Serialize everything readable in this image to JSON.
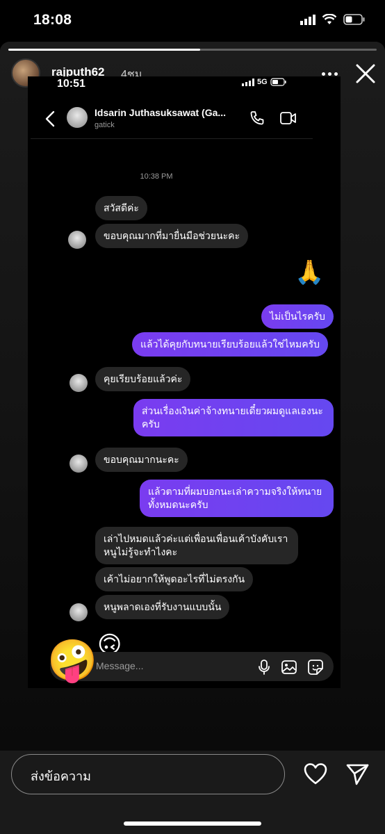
{
  "status_bar": {
    "time": "18:08"
  },
  "story": {
    "progress_fraction": 0.52,
    "username": "rajputh62",
    "time_ago": "4ชม.",
    "icons": [
      "more-icon",
      "close-icon"
    ]
  },
  "screenshot": {
    "status_time": "10:51",
    "network": "5G",
    "chat": {
      "name": "Idsarin Juthasuksawat (Ga...",
      "handle": "gatick",
      "timestamp": "10:38 PM",
      "messages": [
        {
          "side": "in",
          "text": "สวัสดีค่ะ"
        },
        {
          "side": "in",
          "text": "ขอบคุณมากที่มายื่นมือช่วยนะคะ"
        },
        {
          "side": "out",
          "text": "🙏"
        },
        {
          "side": "out",
          "text": "ไม่เป็นไรครับ"
        },
        {
          "side": "out",
          "text": "แล้วได้คุยกับทนายเรียบร้อยแล้วใช่ไหมครับ"
        },
        {
          "side": "in",
          "text": "คุยเรียบร้อยแล้วค่ะ"
        },
        {
          "side": "out",
          "text": "ส่วนเรื่องเงินค่าจ้างทนายเดี๋ยวผมดูแลเองนะครับ"
        },
        {
          "side": "in",
          "text": "ขอบคุณมากนะคะ"
        },
        {
          "side": "out",
          "text": "แล้วตามที่ผมบอกนะเล่าความจริงให้ทนายทั้งหมดนะครับ"
        },
        {
          "side": "in",
          "text": "เล่าไปหมดแล้วค่ะแต่เพื่อนเพื่อนเค้าบังคับเราหนูไม่รู้จะทำไงคะ"
        },
        {
          "side": "in",
          "text": "เค้าไม่อยากให้พูดอะไรที่ไม่ตรงกัน"
        },
        {
          "side": "in",
          "text": "หนูพลาดเองที่รับงานแบบนั้น"
        },
        {
          "side": "in",
          "text": "🙃"
        }
      ],
      "composer_placeholder": "Message...",
      "composer_icons": [
        "microphone-icon",
        "image-icon",
        "sticker-icon"
      ]
    }
  },
  "overlay_sticker": "🤪",
  "reply_bar": {
    "placeholder": "ส่งข้อความ",
    "icons": [
      "heart-icon",
      "send-icon"
    ]
  }
}
